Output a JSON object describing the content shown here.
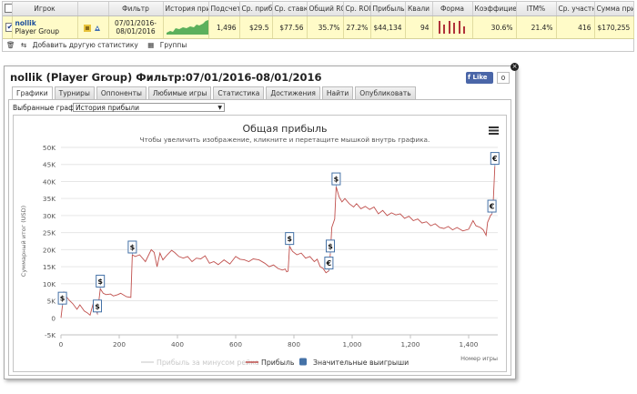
{
  "stats": {
    "headers": [
      "Игрок",
      "Фильтр",
      "История приб",
      "Подсчет",
      "Ср. приб",
      "Ср. ставк",
      "Общий ROI",
      "Ср. ROI",
      "Прибыль",
      "Квали",
      "Форма",
      "Коэффицие",
      "ITM%",
      "Ср. участни",
      "Сумма призо"
    ],
    "row": {
      "name": "nollik",
      "group": "Player Group",
      "filter": "07/01/2016-08/01/2016",
      "count": "1,496",
      "avg_profit": "$29.5",
      "avg_stake": "$77.56",
      "total_roi": "35.7%",
      "avg_roi": "27.2%",
      "profit": "$44,134",
      "qualifier": "94",
      "coefficient": "30.6%",
      "itm": "21.4%",
      "avg_entrants": "416",
      "prize_sum": "$170,255",
      "remove": "x"
    },
    "footer": {
      "add_label": "Добавить другую статистику",
      "groups_label": "Группы"
    }
  },
  "window": {
    "title": "nollik (Player Group) Фильтр:07/01/2016-08/01/2016",
    "fb_like": "Like",
    "fb_count": "0",
    "close": "×",
    "tabs": [
      "Графики",
      "Турниры",
      "Оппоненты",
      "Любимые игры",
      "Статистика",
      "Достижения",
      "Найти",
      "Опубликовать"
    ],
    "active_tab": 0,
    "chart_select_label": "Выбранные графики:",
    "chart_select_value": "История прибыли"
  },
  "colors": {
    "profit_line": "#c0504d",
    "profit_no_rake": "#d9d9d9",
    "big_win": "#4572a7",
    "menu": "#333333"
  },
  "chart_data": {
    "type": "line",
    "title": "Общая прибыль",
    "subtitle": "Чтобы увеличить изображение, кликните и перетащите мышкой внутрь графика.",
    "xlabel": "Номер игры",
    "ylabel": "Суммарный итог (USD)",
    "xlim": [
      0,
      1500
    ],
    "ylim": [
      -5000,
      50000
    ],
    "x_ticks": [
      0,
      200,
      400,
      600,
      800,
      1000,
      1200,
      1400
    ],
    "x_tick_labels": [
      "0",
      "200",
      "400",
      "600",
      "800",
      "1,000",
      "1,200",
      "1,400"
    ],
    "y_ticks": [
      -5000,
      0,
      5000,
      10000,
      15000,
      20000,
      25000,
      30000,
      35000,
      40000,
      45000,
      50000
    ],
    "y_tick_labels": [
      "-5K",
      "0",
      "5K",
      "10K",
      "15K",
      "20K",
      "25K",
      "30K",
      "35K",
      "40K",
      "45K",
      "50K"
    ],
    "legend": [
      "Прибыль за минусом рейка",
      "Прибыль",
      "Значительные выигрыши"
    ],
    "series": [
      {
        "name": "Прибыль",
        "points": [
          [
            0,
            0
          ],
          [
            5,
            3500
          ],
          [
            10,
            7500
          ],
          [
            20,
            6000
          ],
          [
            30,
            5000
          ],
          [
            40,
            4200
          ],
          [
            55,
            2500
          ],
          [
            65,
            3800
          ],
          [
            80,
            2000
          ],
          [
            90,
            1500
          ],
          [
            100,
            800
          ],
          [
            110,
            4000
          ],
          [
            125,
            1200
          ],
          [
            135,
            8500
          ],
          [
            145,
            7200
          ],
          [
            155,
            6800
          ],
          [
            170,
            7000
          ],
          [
            180,
            6400
          ],
          [
            195,
            6800
          ],
          [
            205,
            7200
          ],
          [
            225,
            6200
          ],
          [
            240,
            6000
          ],
          [
            245,
            18500
          ],
          [
            255,
            18000
          ],
          [
            270,
            18500
          ],
          [
            290,
            16500
          ],
          [
            310,
            20000
          ],
          [
            320,
            19200
          ],
          [
            330,
            15000
          ],
          [
            340,
            19000
          ],
          [
            350,
            17000
          ],
          [
            365,
            18500
          ],
          [
            380,
            19800
          ],
          [
            390,
            19200
          ],
          [
            405,
            18000
          ],
          [
            420,
            17500
          ],
          [
            435,
            18000
          ],
          [
            450,
            16500
          ],
          [
            465,
            17500
          ],
          [
            480,
            17300
          ],
          [
            495,
            18200
          ],
          [
            510,
            16000
          ],
          [
            525,
            16500
          ],
          [
            540,
            15600
          ],
          [
            560,
            17000
          ],
          [
            580,
            15800
          ],
          [
            600,
            18000
          ],
          [
            615,
            17200
          ],
          [
            630,
            17000
          ],
          [
            645,
            16500
          ],
          [
            660,
            17300
          ],
          [
            680,
            17000
          ],
          [
            700,
            16000
          ],
          [
            715,
            15000
          ],
          [
            730,
            15500
          ],
          [
            745,
            14500
          ],
          [
            760,
            14000
          ],
          [
            770,
            14300
          ],
          [
            775,
            13500
          ],
          [
            780,
            13700
          ],
          [
            785,
            21000
          ],
          [
            795,
            19500
          ],
          [
            810,
            18500
          ],
          [
            825,
            19000
          ],
          [
            840,
            17500
          ],
          [
            855,
            18000
          ],
          [
            870,
            16500
          ],
          [
            880,
            17200
          ],
          [
            890,
            15000
          ],
          [
            900,
            14500
          ],
          [
            910,
            13200
          ],
          [
            920,
            13800
          ],
          [
            925,
            18800
          ],
          [
            930,
            26500
          ],
          [
            940,
            29000
          ],
          [
            945,
            38500
          ],
          [
            955,
            35500
          ],
          [
            965,
            34000
          ],
          [
            975,
            35000
          ],
          [
            990,
            33500
          ],
          [
            1005,
            32500
          ],
          [
            1015,
            33500
          ],
          [
            1030,
            32000
          ],
          [
            1045,
            32700
          ],
          [
            1060,
            31800
          ],
          [
            1075,
            32500
          ],
          [
            1090,
            30500
          ],
          [
            1105,
            31500
          ],
          [
            1120,
            30000
          ],
          [
            1135,
            30800
          ],
          [
            1150,
            30200
          ],
          [
            1165,
            30500
          ],
          [
            1180,
            29200
          ],
          [
            1195,
            29800
          ],
          [
            1210,
            28500
          ],
          [
            1225,
            29000
          ],
          [
            1240,
            27800
          ],
          [
            1255,
            28200
          ],
          [
            1270,
            27000
          ],
          [
            1285,
            27600
          ],
          [
            1300,
            26500
          ],
          [
            1315,
            26200
          ],
          [
            1330,
            26800
          ],
          [
            1345,
            25800
          ],
          [
            1360,
            26500
          ],
          [
            1380,
            25500
          ],
          [
            1400,
            26000
          ],
          [
            1415,
            28500
          ],
          [
            1425,
            27000
          ],
          [
            1440,
            26500
          ],
          [
            1450,
            25800
          ],
          [
            1460,
            24200
          ],
          [
            1465,
            28000
          ],
          [
            1475,
            30000
          ],
          [
            1480,
            30500
          ],
          [
            1485,
            35000
          ],
          [
            1490,
            44500
          ]
        ]
      }
    ],
    "big_wins": [
      {
        "x": 5,
        "y": 3500,
        "label": "$"
      },
      {
        "x": 135,
        "y": 8500,
        "label": "$"
      },
      {
        "x": 125,
        "y": 1200,
        "label": "$"
      },
      {
        "x": 245,
        "y": 18500,
        "label": "$"
      },
      {
        "x": 785,
        "y": 21000,
        "label": "$"
      },
      {
        "x": 925,
        "y": 18800,
        "label": "$"
      },
      {
        "x": 920,
        "y": 13800,
        "label": "€"
      },
      {
        "x": 945,
        "y": 38500,
        "label": "$"
      },
      {
        "x": 1480,
        "y": 30500,
        "label": "€"
      },
      {
        "x": 1490,
        "y": 44500,
        "label": "€"
      }
    ],
    "grid": true,
    "legend_position": "bottom"
  }
}
